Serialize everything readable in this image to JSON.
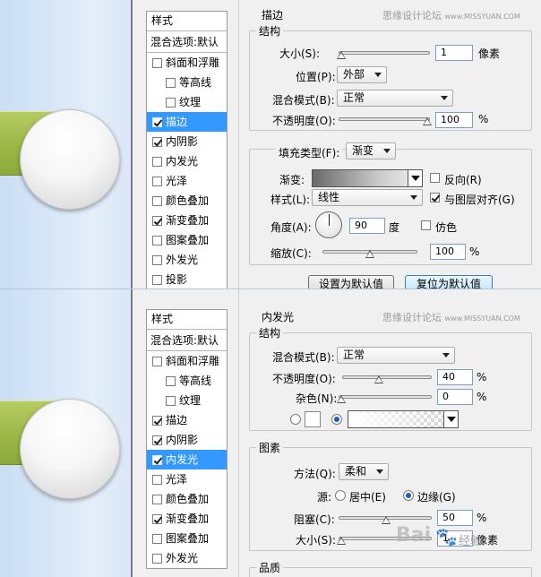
{
  "watermark": {
    "text": "思缘设计论坛",
    "site": "www.MISSYUAN.COM"
  },
  "baidu_watermark": {
    "logo": "Bai",
    "paw": "🐾",
    "suffix": "经验"
  },
  "colors": {
    "selection": "#3399ff",
    "preview_green": "#9cb746",
    "field_border": "#7d9ec4"
  },
  "top": {
    "styles_header": "样式",
    "blend_options": "混合选项:默认",
    "items": [
      {
        "label": "斜面和浮雕",
        "checked": false,
        "sub": false,
        "selected": false
      },
      {
        "label": "等高线",
        "checked": false,
        "sub": true,
        "selected": false
      },
      {
        "label": "纹理",
        "checked": false,
        "sub": true,
        "selected": false
      },
      {
        "label": "描边",
        "checked": true,
        "sub": false,
        "selected": true
      },
      {
        "label": "内阴影",
        "checked": true,
        "sub": false,
        "selected": false
      },
      {
        "label": "内发光",
        "checked": false,
        "sub": false,
        "selected": false
      },
      {
        "label": "光泽",
        "checked": false,
        "sub": false,
        "selected": false
      },
      {
        "label": "颜色叠加",
        "checked": false,
        "sub": false,
        "selected": false
      },
      {
        "label": "渐变叠加",
        "checked": true,
        "sub": false,
        "selected": false
      },
      {
        "label": "图案叠加",
        "checked": false,
        "sub": false,
        "selected": false
      },
      {
        "label": "外发光",
        "checked": false,
        "sub": false,
        "selected": false
      },
      {
        "label": "投影",
        "checked": false,
        "sub": false,
        "selected": false
      }
    ],
    "section_title": "描边",
    "structure_legend": "结构",
    "size_label": "大小(S):",
    "size_value": "1",
    "size_unit": "像素",
    "position_label": "位置(P):",
    "position_value": "外部",
    "blend_label": "混合模式(B):",
    "blend_value": "正常",
    "opacity_label": "不透明度(O):",
    "opacity_value": "100",
    "opacity_unit": "%",
    "fill_type_label": "填充类型(F):",
    "fill_type_value": "渐变",
    "gradient_label": "渐变:",
    "reverse_label": "反向(R)",
    "style_label": "样式(L):",
    "style_value": "线性",
    "align_label": "与图层对齐(G)",
    "angle_label": "角度(A):",
    "angle_value": "90",
    "angle_unit": "度",
    "dither_label": "仿色",
    "scale_label": "缩放(C):",
    "scale_value": "100",
    "scale_unit": "%",
    "btn_set_default": "设置为默认值",
    "btn_reset_default": "复位为默认值"
  },
  "bottom": {
    "styles_header": "样式",
    "blend_options": "混合选项:默认",
    "items": [
      {
        "label": "斜面和浮雕",
        "checked": false,
        "sub": false,
        "selected": false
      },
      {
        "label": "等高线",
        "checked": false,
        "sub": true,
        "selected": false
      },
      {
        "label": "纹理",
        "checked": false,
        "sub": true,
        "selected": false
      },
      {
        "label": "描边",
        "checked": true,
        "sub": false,
        "selected": false
      },
      {
        "label": "内阴影",
        "checked": true,
        "sub": false,
        "selected": false
      },
      {
        "label": "内发光",
        "checked": true,
        "sub": false,
        "selected": true
      },
      {
        "label": "光泽",
        "checked": false,
        "sub": false,
        "selected": false
      },
      {
        "label": "颜色叠加",
        "checked": false,
        "sub": false,
        "selected": false
      },
      {
        "label": "渐变叠加",
        "checked": true,
        "sub": false,
        "selected": false
      },
      {
        "label": "图案叠加",
        "checked": false,
        "sub": false,
        "selected": false
      },
      {
        "label": "外发光",
        "checked": false,
        "sub": false,
        "selected": false
      }
    ],
    "section_title": "内发光",
    "structure_legend": "结构",
    "blend_label": "混合模式(B):",
    "blend_value": "正常",
    "opacity_label": "不透明度(O):",
    "opacity_value": "40",
    "opacity_unit": "%",
    "noise_label": "杂色(N):",
    "noise_value": "0",
    "noise_unit": "%",
    "elements_legend": "图素",
    "method_label": "方法(Q):",
    "method_value": "柔和",
    "source_label": "源:",
    "source_center": "居中(E)",
    "source_edge": "边缘(G)",
    "choke_label": "阻塞(C):",
    "choke_value": "50",
    "choke_unit": "%",
    "size_label": "大小(S):",
    "size_value": "1",
    "size_unit": "像素",
    "quality_legend": "品质"
  }
}
